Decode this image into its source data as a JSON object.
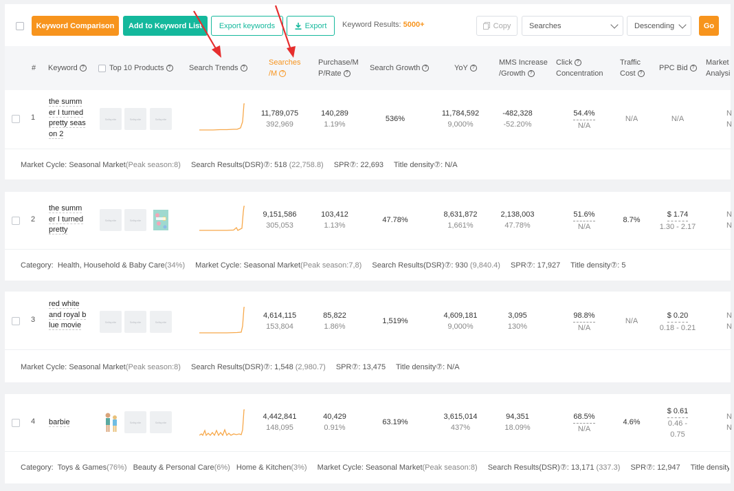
{
  "toolbar": {
    "keyword_comparison": "Keyword Comparison",
    "add_to_list": "Add to Keyword List",
    "export_keywords": "Export keywords",
    "export": "Export",
    "results_label": "Keyword Results:",
    "results_value": "5000+",
    "copy": "Copy",
    "sort_field": "Searches",
    "sort_order": "Descending",
    "go": "Go"
  },
  "columns": {
    "index": "#",
    "keyword": "Keyword",
    "top10": "Top 10 Products",
    "trends": "Search Trends",
    "searches_1": "Searches",
    "searches_2": "/M",
    "purchase_1": "Purchase/M",
    "purchase_2": "P/Rate",
    "growth": "Search Growth",
    "yoy": "YoY",
    "mms_1": "MMS Increase",
    "mms_2": "/Growth",
    "click_1": "Click",
    "click_2": "Concentration",
    "traffic_1": "Traffic",
    "traffic_2": "Cost",
    "ppc": "PPC Bid",
    "market_1": "Market",
    "market_2": "Analysi"
  },
  "rows": [
    {
      "num": "1",
      "keyword": "the summer I turned pretty season 2",
      "kw_lines": [
        "the summ",
        "er I turned",
        "pretty seas",
        "on 2"
      ],
      "searches": "11,789,075",
      "searches_sub": "392,969",
      "purchase": "140,289",
      "purchase_sub": "1.19%",
      "growth": "536%",
      "yoy": "11,784,592",
      "yoy_sub": "9,000%",
      "mms": "-482,328",
      "mms_sub": "-52.20%",
      "click": "54.4%",
      "click_sub": "N/A",
      "traffic": "N/A",
      "ppc": "N/A",
      "ppc_sub": "",
      "market_a": "N",
      "market_b": "N",
      "details": [
        {
          "label": "Market Cycle:",
          "value": "Seasonal Market",
          "extra": "(Peak season:8)"
        },
        {
          "label": "Search Results(DSR)⑦:",
          "value": "518",
          "extra": "(22,758.8)"
        },
        {
          "label": "SPR⑦:",
          "value": "22,693",
          "extra": ""
        },
        {
          "label": "Title density⑦:",
          "value": "N/A",
          "extra": ""
        }
      ]
    },
    {
      "num": "2",
      "keyword": "the summer I turned pretty",
      "kw_lines": [
        "the summ",
        "er I turned",
        "pretty"
      ],
      "searches": "9,151,586",
      "searches_sub": "305,053",
      "purchase": "103,412",
      "purchase_sub": "1.13%",
      "growth": "47.78%",
      "yoy": "8,631,872",
      "yoy_sub": "1,661%",
      "mms": "2,138,003",
      "mms_sub": "47.78%",
      "click": "51.6%",
      "click_sub": "N/A",
      "traffic": "8.7%",
      "ppc": "$ 1.74",
      "ppc_sub": "1.30 - 2.17",
      "market_a": "N",
      "market_b": "N",
      "details": [
        {
          "label": "Category:",
          "value": "Health, Household & Baby Care",
          "extra": "(34%)"
        },
        {
          "label": "Market Cycle:",
          "value": "Seasonal Market",
          "extra": "(Peak season:7,8)"
        },
        {
          "label": "Search Results(DSR)⑦:",
          "value": "930",
          "extra": "(9,840.4)"
        },
        {
          "label": "SPR⑦:",
          "value": "17,927",
          "extra": ""
        },
        {
          "label": "Title density⑦:",
          "value": "5",
          "extra": ""
        }
      ]
    },
    {
      "num": "3",
      "keyword": "red white and royal blue movie",
      "kw_lines": [
        "red white",
        "and royal b",
        "lue movie"
      ],
      "searches": "4,614,115",
      "searches_sub": "153,804",
      "purchase": "85,822",
      "purchase_sub": "1.86%",
      "growth": "1,519%",
      "yoy": "4,609,181",
      "yoy_sub": "9,000%",
      "mms": "3,095",
      "mms_sub": "130%",
      "click": "98.8%",
      "click_sub": "N/A",
      "traffic": "N/A",
      "ppc": "$ 0.20",
      "ppc_sub": "0.18 - 0.21",
      "market_a": "N",
      "market_b": "N",
      "details": [
        {
          "label": "Market Cycle:",
          "value": "Seasonal Market",
          "extra": "(Peak season:8)"
        },
        {
          "label": "Search Results(DSR)⑦:",
          "value": "1,548",
          "extra": "(2,980.7)"
        },
        {
          "label": "SPR⑦:",
          "value": "13,475",
          "extra": ""
        },
        {
          "label": "Title density⑦:",
          "value": "N/A",
          "extra": ""
        }
      ]
    },
    {
      "num": "4",
      "keyword": "barbie",
      "kw_lines": [
        "barbie"
      ],
      "searches": "4,442,841",
      "searches_sub": "148,095",
      "purchase": "40,429",
      "purchase_sub": "0.91%",
      "growth": "63.19%",
      "yoy": "3,615,014",
      "yoy_sub": "437%",
      "mms": "94,351",
      "mms_sub": "18.09%",
      "click": "68.5%",
      "click_sub": "N/A",
      "traffic": "4.6%",
      "ppc": "$ 0.61",
      "ppc_sub": "0.46 -",
      "ppc_sub2": "0.75",
      "market_a": "N",
      "market_b": "N",
      "details": [
        {
          "label": "Category:",
          "value": "Toys & Games",
          "extra": "(76%)"
        },
        {
          "label": "",
          "value": "Beauty & Personal Care",
          "extra": "(6%)"
        },
        {
          "label": "",
          "value": "Home & Kitchen",
          "extra": "(3%)"
        },
        {
          "label": "Market Cycle:",
          "value": "Seasonal Market",
          "extra": "(Peak season:8)"
        },
        {
          "label": "Search Results(DSR)⑦:",
          "value": "13,171",
          "extra": "(337.3)"
        },
        {
          "label": "SPR⑦:",
          "value": "12,947",
          "extra": ""
        },
        {
          "label": "Title density",
          "value": "",
          "extra": ""
        }
      ]
    }
  ],
  "thumb_placeholder": "Sellsprite",
  "icons": {
    "export": "download-icon",
    "copy": "copy-icon",
    "help": "question-circle-icon",
    "dropdown": "chevron-down-icon"
  },
  "colors": {
    "orange": "#f7941d",
    "teal": "#14b89c",
    "trend": "#f7a84a",
    "arrow": "#e62e2e"
  }
}
